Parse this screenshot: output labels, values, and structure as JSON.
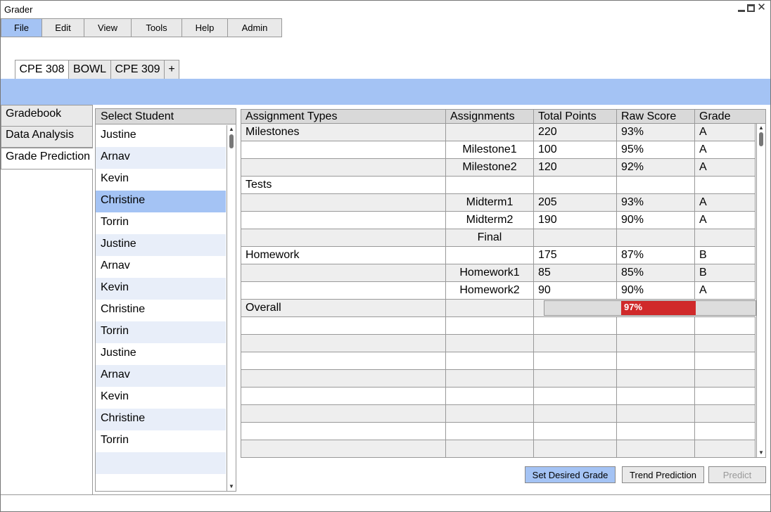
{
  "window": {
    "title": "Grader"
  },
  "menu": [
    "File",
    "Edit",
    "View",
    "Tools",
    "Help",
    "Admin"
  ],
  "course_tabs": [
    "CPE 308",
    "BOWL",
    "CPE 309",
    "+"
  ],
  "side_nav": [
    "Gradebook",
    "Data Analysis",
    "Grade Prediction"
  ],
  "students": {
    "header": "Select Student",
    "names": [
      "Justine",
      "Arnav",
      "Kevin",
      "Christine",
      "Torrin",
      "Justine",
      "Arnav",
      "Kevin",
      "Christine",
      "Torrin",
      "Justine",
      "Arnav",
      "Kevin",
      "Christine",
      "Torrin",
      ""
    ],
    "selected": "Christine"
  },
  "grades": {
    "columns": [
      "Assignment Types",
      "Assignments",
      "Total Points",
      "Raw Score",
      "Grade"
    ],
    "rows": [
      [
        "Milestones",
        "",
        "220",
        "93%",
        "A"
      ],
      [
        "",
        "Milestone1",
        "100",
        "95%",
        "A"
      ],
      [
        "",
        "Milestone2",
        "120",
        "92%",
        "A"
      ],
      [
        "Tests",
        "",
        "",
        "",
        ""
      ],
      [
        "",
        "Midterm1",
        "205",
        "93%",
        "A"
      ],
      [
        "",
        "Midterm2",
        "190",
        "90%",
        "A"
      ],
      [
        "",
        "Final",
        "",
        "",
        ""
      ],
      [
        "Homework",
        "",
        "175",
        "87%",
        "B"
      ],
      [
        "",
        "Homework1",
        "85",
        "85%",
        "B"
      ],
      [
        "",
        "Homework2",
        "90",
        "90%",
        "A"
      ]
    ],
    "overall": {
      "label": "Overall",
      "value": "97%",
      "percent": 97
    }
  },
  "buttons": {
    "set_desired": "Set Desired Grade",
    "trend": "Trend Prediction",
    "predict": "Predict"
  },
  "colors": {
    "accent": "#a4c3f4",
    "progress": "#d0292a"
  }
}
